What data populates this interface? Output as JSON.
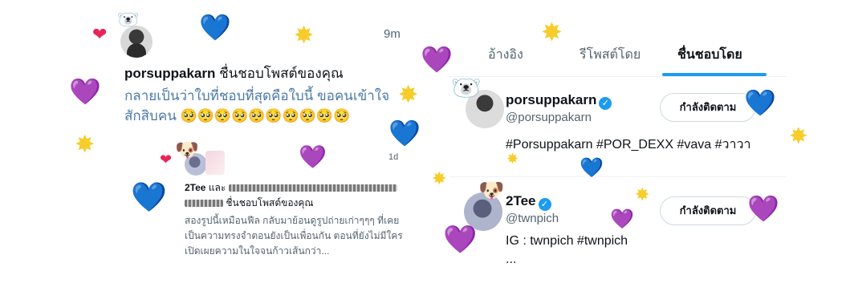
{
  "notification_1": {
    "time": "9m",
    "username": "porsuppakarn",
    "action": "ชื่นชอบโพสต์ของคุณ",
    "body": "กลายเป็นว่าใบที่ชอบที่สุดคือใบนี้ ขอคนเข้าใจสักสิบคน 🥺🥺🥺🥺🥺🥺🥺🥺🥺🥺"
  },
  "notification_2": {
    "time": "1d",
    "username": "2Tee",
    "connector": "และ",
    "action": "ชื่นชอบโพสต์ของคุณ",
    "body": "สองรูปนี้เหมือนฟีล กลับมาย้อนดูรูปถ่ายเก่าๆๆๆ ที่เคยเป็นความทรงจำตอนยังเป็นเพื่อนกัน ตอนที่ยังไม่มีใครเปิดเผยความในใจจนก้าวเส้นกว่า..."
  },
  "tabs": [
    {
      "label": "อ้างอิง",
      "active": false
    },
    {
      "label": "รีโพสต์โดย",
      "active": false
    },
    {
      "label": "ชื่นชอบโดย",
      "active": true
    }
  ],
  "users": [
    {
      "name": "porsuppakarn",
      "handle": "@porsuppakarn",
      "bio": "#Porsuppakarn #POR_DEXX #vava #วาวา",
      "button": "กำลังติดตาม"
    },
    {
      "name": "2Tee",
      "handle": "@twnpich",
      "bio": "IG : twnpich #twnpich",
      "bio2": "...",
      "button": "กำลังติดตาม"
    }
  ],
  "stickers": {
    "purple_heart": "💜",
    "blue_heart": "💙",
    "red_heart": "❤",
    "sparkle": "✸",
    "polar_bear": "🐻‍❄️",
    "dog": "🐶",
    "pleading": "🥺"
  },
  "colors": {
    "accent": "#1d9bf0",
    "body_link": "#4b79a8",
    "muted": "#536471"
  }
}
